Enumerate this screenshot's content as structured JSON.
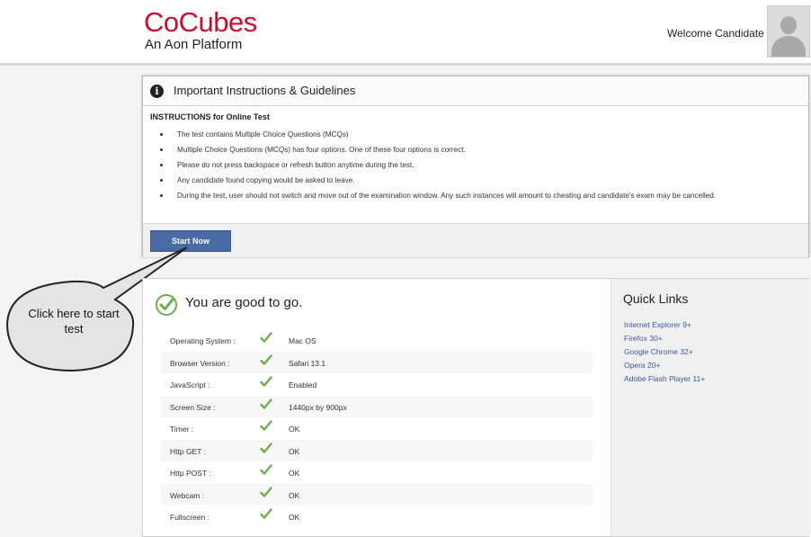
{
  "header": {
    "logo_main": "CoCubes",
    "logo_sub": "An Aon Platform",
    "welcome": "Welcome Candidate"
  },
  "instructions": {
    "title": "Important Instructions & Guidelines",
    "subtitle": "INSTRUCTIONS for Online Test",
    "items": [
      "The test contains Multiple Choice Questions (MCQs)",
      "Multiple Choice Questions (MCQs) has four options. One of these four options is correct.",
      "Please do not press backspace or refresh button anytime during the test.",
      "Any candidate found copying would be asked to leave.",
      "During the test, user should not switch and move out of the examination window. Any such instances will amount to cheating and candidate's exam may be cancelled."
    ],
    "start_button": "Start Now"
  },
  "callout": {
    "text": "Click here to start test"
  },
  "system_check": {
    "status": "You are good to go.",
    "rows": [
      {
        "label": "Operating System :",
        "value": "Mac OS"
      },
      {
        "label": "Browser Version :",
        "value": "Safari 13.1"
      },
      {
        "label": "JavaScript :",
        "value": "Enabled"
      },
      {
        "label": "Screen Size :",
        "value": "1440px by 900px"
      },
      {
        "label": "Timer :",
        "value": "OK"
      },
      {
        "label": "Http GET :",
        "value": "OK"
      },
      {
        "label": "Http POST :",
        "value": "OK"
      },
      {
        "label": "Webcam :",
        "value": "OK"
      },
      {
        "label": "Fullscreen :",
        "value": "OK"
      }
    ]
  },
  "quick_links": {
    "title": "Quick Links",
    "links": [
      "Internet Explorer 9+",
      "Firefox 30+",
      "Google Chrome 32+",
      "Opera 20+",
      "Adobe Flash Player 11+"
    ]
  },
  "colors": {
    "brand": "#c8102e",
    "button": "#4a6aa5",
    "check": "#6ab04c",
    "link": "#3a5a9a"
  }
}
